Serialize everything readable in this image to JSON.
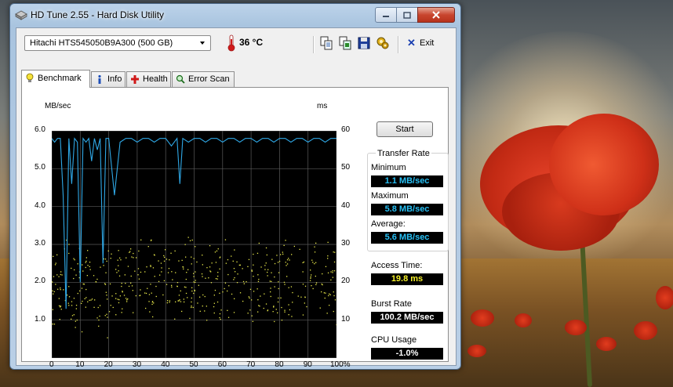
{
  "window": {
    "title": "HD Tune 2.55 - Hard Disk Utility"
  },
  "toolbar": {
    "drive": "Hitachi HTS545050B9A300 (500 GB)",
    "temperature": "36 °C",
    "exit_label": "Exit"
  },
  "tabs": [
    {
      "label": "Benchmark",
      "active": true
    },
    {
      "label": "Info",
      "active": false
    },
    {
      "label": "Health",
      "active": false
    },
    {
      "label": "Error Scan",
      "active": false
    }
  ],
  "chart": {
    "left_unit": "MB/sec",
    "right_unit": "ms",
    "left_ticks": [
      "6.0",
      "5.0",
      "4.0",
      "3.0",
      "2.0",
      "1.0"
    ],
    "right_ticks": [
      "60",
      "50",
      "40",
      "30",
      "20",
      "10"
    ],
    "x_ticks": [
      "0",
      "10",
      "20",
      "30",
      "40",
      "50",
      "60",
      "70",
      "80",
      "90",
      "100%"
    ]
  },
  "chart_data": {
    "type": "line",
    "xlabel": "",
    "ylabel": "MB/sec",
    "y2label": "ms",
    "xlim": [
      0,
      100
    ],
    "ylim": [
      0,
      6.0
    ],
    "y2lim": [
      0,
      60
    ],
    "grid": true,
    "transfer_rate": {
      "color": "#2fa8e6",
      "x": [
        0,
        1,
        2,
        3,
        4,
        5,
        6,
        7,
        8,
        9,
        10,
        11,
        12,
        13,
        14,
        15,
        16,
        17,
        18,
        19,
        20,
        22,
        24,
        26,
        28,
        30,
        32,
        34,
        36,
        38,
        40,
        42,
        44,
        45,
        46,
        48,
        50,
        52,
        54,
        56,
        58,
        60,
        62,
        64,
        66,
        68,
        70,
        72,
        74,
        76,
        78,
        80,
        82,
        84,
        86,
        88,
        90,
        92,
        94,
        96,
        98,
        100
      ],
      "y": [
        5.8,
        5.7,
        5.8,
        5.8,
        4.3,
        1.3,
        5.8,
        4.6,
        5.8,
        5.7,
        2.0,
        5.8,
        5.7,
        5.8,
        5.2,
        5.8,
        5.5,
        5.8,
        2.5,
        5.8,
        5.8,
        4.3,
        5.7,
        5.8,
        5.8,
        5.7,
        5.8,
        5.8,
        5.7,
        5.8,
        5.8,
        5.6,
        5.8,
        4.6,
        5.8,
        5.7,
        5.8,
        5.8,
        5.7,
        5.8,
        5.8,
        5.7,
        5.8,
        5.8,
        5.7,
        5.8,
        5.8,
        5.7,
        5.8,
        5.8,
        5.7,
        5.8,
        5.8,
        5.7,
        5.8,
        5.8,
        5.7,
        5.8,
        5.8,
        5.7,
        5.8,
        5.8
      ]
    },
    "access_time_scatter": {
      "color": "#e8e84a",
      "description_range_ms": [
        5,
        35
      ]
    }
  },
  "results": {
    "start_label": "Start",
    "transfer_rate_title": "Transfer Rate",
    "minimum_label": "Minimum",
    "minimum_value": "1.1 MB/sec",
    "maximum_label": "Maximum",
    "maximum_value": "5.8 MB/sec",
    "average_label": "Average:",
    "average_value": "5.6 MB/sec",
    "access_time_label": "Access Time:",
    "access_time_value": "19.8 ms",
    "burst_rate_label": "Burst Rate",
    "burst_rate_value": "100.2 MB/sec",
    "cpu_usage_label": "CPU Usage",
    "cpu_usage_value": "-1.0%"
  },
  "colors": {
    "transfer_line": "#2fa8e6",
    "access_dots": "#e8e84a",
    "value_cyan": "#27c0f5",
    "value_yellow": "#f5f02a"
  }
}
